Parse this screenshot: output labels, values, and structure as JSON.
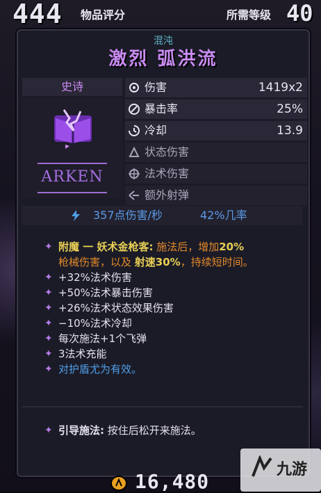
{
  "header": {
    "item_score": "444",
    "item_score_label": "物品评分",
    "required_level_label": "所需等级",
    "required_level": "40"
  },
  "item": {
    "type": "混沌",
    "name": "激烈 弧洪流",
    "rarity": "史诗",
    "manufacturer": "ARKEN"
  },
  "stats": [
    {
      "label": "伤害",
      "value": "1419x2",
      "icon": "damage-icon"
    },
    {
      "label": "暴击率",
      "value": "25%",
      "icon": "crit-icon"
    },
    {
      "label": "冷却",
      "value": "13.9",
      "icon": "cooldown-icon"
    },
    {
      "label": "状态伤害",
      "value": "",
      "icon": "status-icon"
    },
    {
      "label": "法术伤害",
      "value": "",
      "icon": "spell-icon"
    },
    {
      "label": "额外射弹",
      "value": "",
      "icon": "projectile-icon"
    }
  ],
  "dps": {
    "damage_per_sec": "357点伤害/秒",
    "chance": "42%几率",
    "icon": "lightning-icon"
  },
  "perks": {
    "enchant_name": "附魔 一 妖术金枪客:",
    "enchant_text_1": "施法后，增加",
    "enchant_value_1": "20%",
    "enchant_text_2": "枪械伤害，以及",
    "enchant_hl_2": "射速30%",
    "enchant_text_3": "，持续短时间。",
    "lines": [
      "+32%法术伤害",
      "+50%法术暴击伤害",
      "+26%法术状态效果伤害",
      "−10%法术冷却",
      "每次施法+1个飞弹",
      "3法术充能"
    ],
    "ward_line": "对护盾尤为有效。"
  },
  "channel": {
    "label": "引导施法:",
    "text": "按住后松开来施法。"
  },
  "footer": {
    "value": "16,480"
  },
  "watermark": {
    "text": "九游"
  },
  "colors": {
    "title": "#c98bf2",
    "subtitle": "#5fb6c6",
    "enchant": "#e38a2a",
    "highlight": "#e8cf55",
    "blue": "#4f9fe8"
  }
}
